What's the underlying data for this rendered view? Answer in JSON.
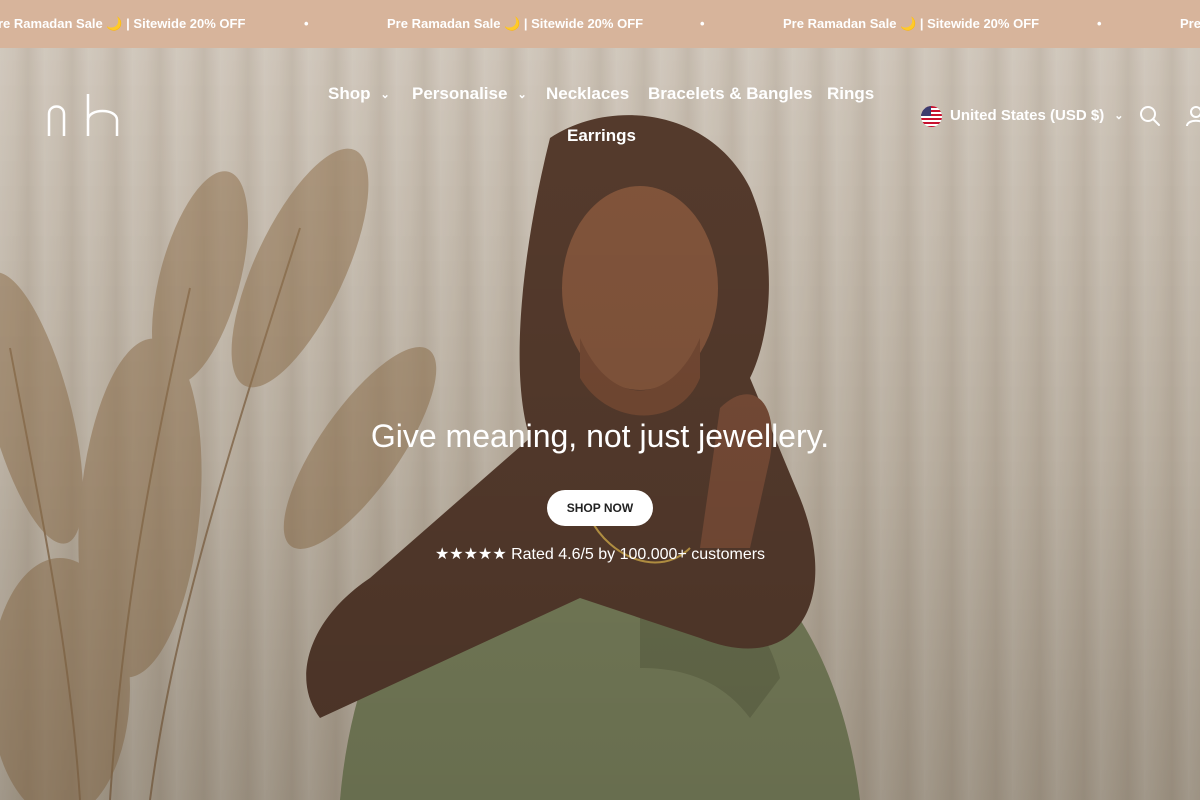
{
  "announcement": {
    "items": [
      "re Ramadan Sale 🌙 | Sitewide 20% OFF",
      "Pre Ramadan Sale 🌙 | Sitewide 20% OFF",
      "Pre Ramadan Sale 🌙 | Sitewide 20% OFF",
      "Pre"
    ],
    "separator": "•"
  },
  "header": {
    "logo_text": "nh",
    "nav": [
      {
        "label": "Shop",
        "has_dropdown": true
      },
      {
        "label": "Personalise",
        "has_dropdown": true
      },
      {
        "label": "Necklaces",
        "has_dropdown": false
      },
      {
        "label": "Bracelets & Bangles",
        "has_dropdown": false
      },
      {
        "label": "Rings",
        "has_dropdown": false
      },
      {
        "label": "Earrings",
        "has_dropdown": false
      }
    ],
    "chevron": "⌄",
    "locale": "United States (USD $)",
    "icons": [
      "us-flag-icon",
      "search-icon",
      "account-icon"
    ]
  },
  "hero": {
    "title": "Give meaning, not just jewellery.",
    "button_label": "SHOP NOW",
    "rating": "★★★★★ Rated 4.6/5 by 100.000+ customers"
  },
  "colors": {
    "announcement_bg": "#d7b49b",
    "text_light": "#ffffff",
    "button_bg": "#ffffff"
  }
}
